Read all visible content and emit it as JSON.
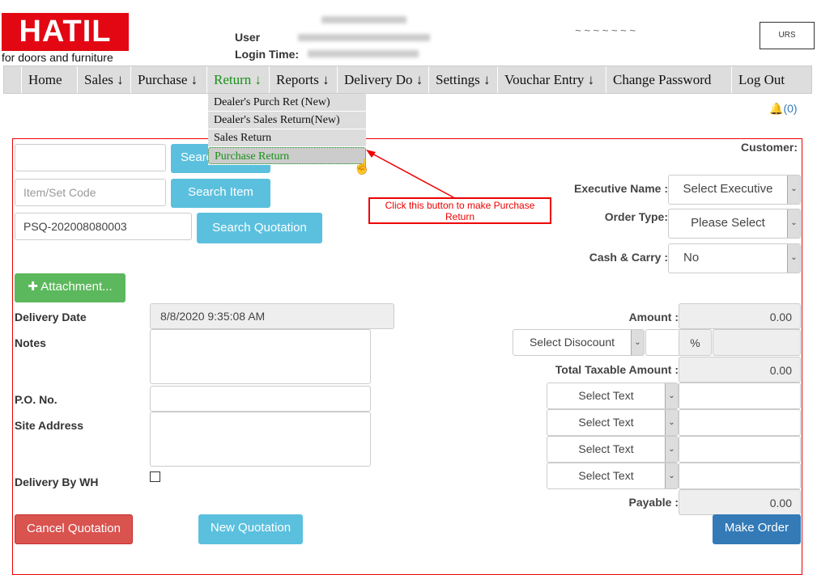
{
  "brand": {
    "logo": "HATIL",
    "tagline": "for doors and furniture"
  },
  "header": {
    "user_label": "User",
    "login_time_label": "Login Time:",
    "notifications": "(0)"
  },
  "nav": [
    "Home",
    "Sales ↓",
    "Purchase ↓",
    "Return ↓",
    "Reports ↓",
    "Delivery Do ↓",
    "Settings ↓",
    "Vouchar Entry ↓",
    "Change Password",
    "Log Out"
  ],
  "return_menu": [
    "Dealer's Purch Ret (New)",
    "Dealer's Sales Return(New)",
    "Sales Return",
    "Purchase Return"
  ],
  "callout": "Click this button to make Purchase Return",
  "form": {
    "customer_label": "Customer:",
    "search_customer": "Search",
    "item_placeholder": "Item/Set Code",
    "search_item": "Search Item",
    "quotation_value": "PSQ-202008080003",
    "search_quotation": "Search Quotation",
    "attachment": "Attachment...",
    "delivery_date_label": "Delivery Date",
    "delivery_date": "8/8/2020 9:35:08 AM",
    "notes_label": "Notes",
    "po_label": "P.O. No.",
    "site_label": "Site Address",
    "delivery_wh_label": "Delivery By WH",
    "executive_label": "Executive Name :",
    "executive": "Select Executive",
    "order_type_label": "Order Type:",
    "order_type": "Please Select",
    "cash_carry_label": "Cash & Carry :",
    "cash_carry": "No",
    "amount_label": "Amount :",
    "amount": "0.00",
    "discount": "Select Disocount",
    "percent": "%",
    "taxable_label": "Total Taxable Amount :",
    "taxable": "0.00",
    "select_text": [
      "Select Text",
      "Select Text",
      "Select Text",
      "Select Text"
    ],
    "payable_label": "Payable :",
    "payable": "0.00",
    "cancel": "Cancel Quotation",
    "new": "New Quotation",
    "make_order": "Make Order"
  }
}
